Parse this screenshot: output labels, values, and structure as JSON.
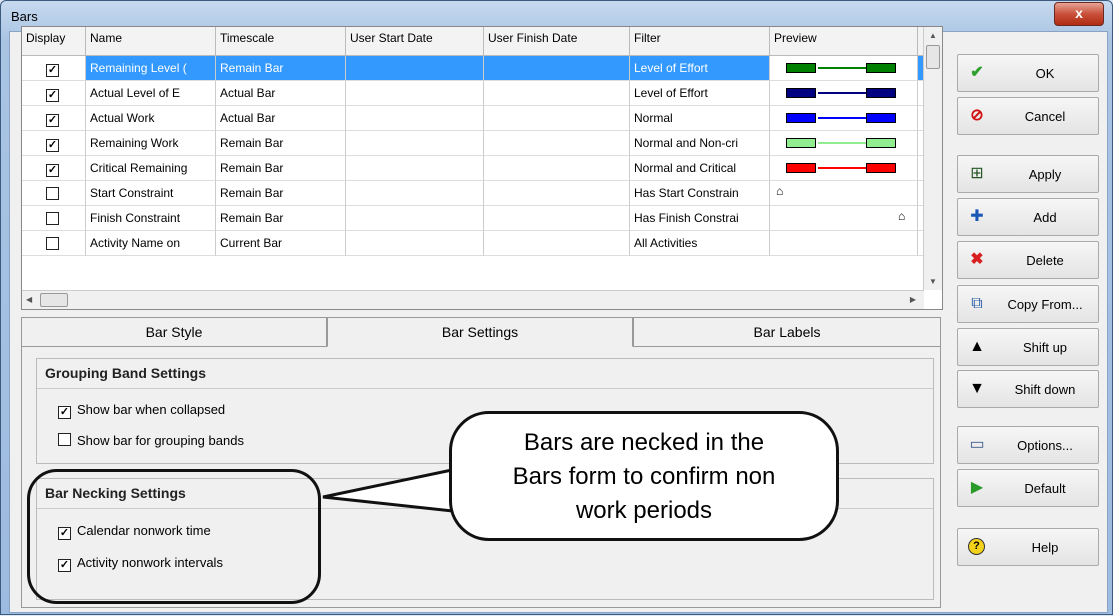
{
  "window": {
    "title": "Bars",
    "close_label": "x"
  },
  "grid": {
    "columns": [
      "Display",
      "Name",
      "Timescale",
      "User Start Date",
      "User Finish Date",
      "Filter",
      "Preview"
    ],
    "rows": [
      {
        "display": true,
        "name": "Remaining Level (",
        "timescale": "Remain Bar",
        "start": "",
        "finish": "",
        "filter": "Level of Effort",
        "preview": "bar",
        "color": "#008000",
        "selected": true
      },
      {
        "display": true,
        "name": "Actual Level of E",
        "timescale": "Actual Bar",
        "start": "",
        "finish": "",
        "filter": "Level of Effort",
        "preview": "bar",
        "color": "#000080",
        "selected": false
      },
      {
        "display": true,
        "name": "Actual Work",
        "timescale": "Actual Bar",
        "start": "",
        "finish": "",
        "filter": "Normal",
        "preview": "bar",
        "color": "#0000ff",
        "selected": false
      },
      {
        "display": true,
        "name": "Remaining Work",
        "timescale": "Remain Bar",
        "start": "",
        "finish": "",
        "filter": "Normal and Non-cri",
        "preview": "bar",
        "color": "#90ee90",
        "selected": false
      },
      {
        "display": true,
        "name": "Critical Remaining",
        "timescale": "Remain Bar",
        "start": "",
        "finish": "",
        "filter": "Normal and Critical",
        "preview": "bar",
        "color": "#ff0000",
        "selected": false
      },
      {
        "display": false,
        "name": "Start Constraint",
        "timescale": "Remain Bar",
        "start": "",
        "finish": "",
        "filter": "Has Start Constrain",
        "preview": "start-marker",
        "color": "",
        "selected": false
      },
      {
        "display": false,
        "name": "Finish Constraint",
        "timescale": "Remain Bar",
        "start": "",
        "finish": "",
        "filter": "Has Finish Constrai",
        "preview": "finish-marker",
        "color": "",
        "selected": false
      },
      {
        "display": false,
        "name": "Activity Name on",
        "timescale": "Current Bar",
        "start": "",
        "finish": "",
        "filter": "All Activities",
        "preview": "none",
        "color": "",
        "selected": false
      }
    ]
  },
  "tabs": [
    "Bar Style",
    "Bar Settings",
    "Bar Labels"
  ],
  "active_tab": "Bar Settings",
  "grouping": {
    "title": "Grouping Band Settings",
    "options": [
      {
        "label": "Show bar when collapsed",
        "checked": true
      },
      {
        "label": "Show bar for grouping bands",
        "checked": false
      }
    ]
  },
  "necking": {
    "title": "Bar Necking Settings",
    "options": [
      {
        "label": "Calendar nonwork time",
        "checked": true
      },
      {
        "label": "Activity nonwork intervals",
        "checked": true
      }
    ]
  },
  "buttons": {
    "ok": "OK",
    "cancel": "Cancel",
    "apply": "Apply",
    "add": "Add",
    "delete": "Delete",
    "copy_from": "Copy From...",
    "shift_up": "Shift up",
    "shift_down": "Shift down",
    "options": "Options...",
    "default": "Default",
    "help": "Help"
  },
  "callout": {
    "line1": "Bars are necked in the",
    "line2": "Bars form to confirm non",
    "line3": "work periods"
  },
  "check_mark": "✓"
}
